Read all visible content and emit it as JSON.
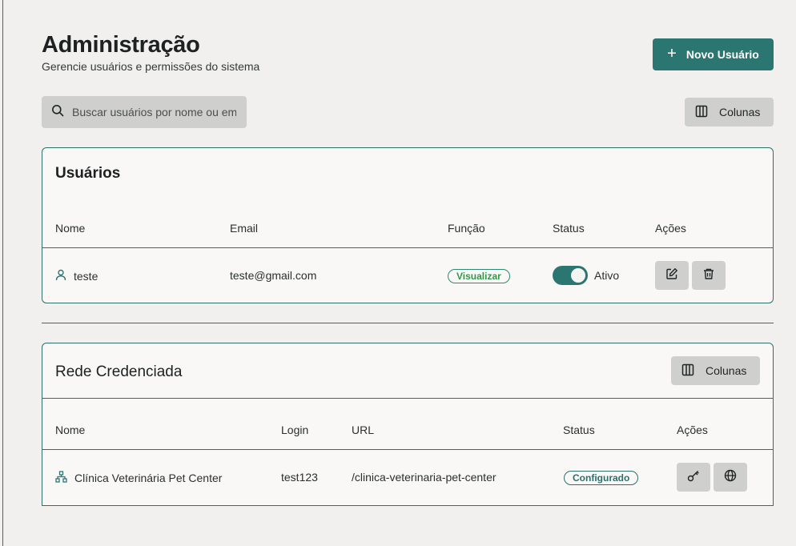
{
  "header": {
    "title": "Administração",
    "subtitle": "Gerencie usuários e permissões do sistema",
    "new_user_label": "Novo Usuário"
  },
  "search": {
    "placeholder": "Buscar usuários por nome ou email"
  },
  "columns_label": "Colunas",
  "users_table": {
    "title": "Usuários",
    "headers": [
      "Nome",
      "Email",
      "Função",
      "Status",
      "Ações"
    ],
    "rows": [
      {
        "name": "teste",
        "email": "teste@gmail.com",
        "role": "Visualizar",
        "active": true,
        "status_label": "Ativo"
      }
    ]
  },
  "network_table": {
    "title": "Rede Credenciada",
    "columns_label": "Colunas",
    "headers": [
      "Nome",
      "Login",
      "URL",
      "Status",
      "Ações"
    ],
    "rows": [
      {
        "name": "Clínica Veterinária Pet Center",
        "login": "test123",
        "url": "/clinica-veterinaria-pet-center",
        "status": "Configurado"
      }
    ]
  },
  "colors": {
    "accent": "#2c7672",
    "badge_green": "#2d9a45",
    "button_gray": "#cfcfcd"
  },
  "icons": [
    "plus-icon",
    "search-icon",
    "columns-icon",
    "user-icon",
    "edit-icon",
    "trash-icon",
    "network-icon",
    "key-icon",
    "globe-icon"
  ]
}
